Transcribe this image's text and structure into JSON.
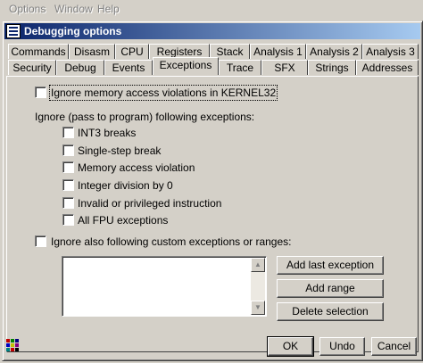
{
  "menubar": {
    "items": [
      "Options",
      "Window",
      "Help"
    ]
  },
  "dialog": {
    "title": "Debugging options"
  },
  "tabs": {
    "row1": [
      "Commands",
      "Disasm",
      "CPU",
      "Registers",
      "Stack",
      "Analysis 1",
      "Analysis 2",
      "Analysis 3"
    ],
    "row2": [
      "Security",
      "Debug",
      "Events",
      "Exceptions",
      "Trace",
      "SFX",
      "Strings",
      "Addresses"
    ],
    "active": "Exceptions"
  },
  "exceptions": {
    "ignore_kernel32": "Ignore memory access violations in KERNEL32",
    "group_label": "Ignore (pass to program) following exceptions:",
    "options": [
      "INT3 breaks",
      "Single-step break",
      "Memory access violation",
      "Integer division by 0",
      "Invalid or privileged instruction",
      "All FPU exceptions"
    ],
    "custom_label": "Ignore also following custom exceptions or ranges:"
  },
  "side_buttons": {
    "add_last": "Add last exception",
    "add_range": "Add range",
    "delete": "Delete selection"
  },
  "footer": {
    "ok": "OK",
    "undo": "Undo",
    "cancel": "Cancel"
  }
}
